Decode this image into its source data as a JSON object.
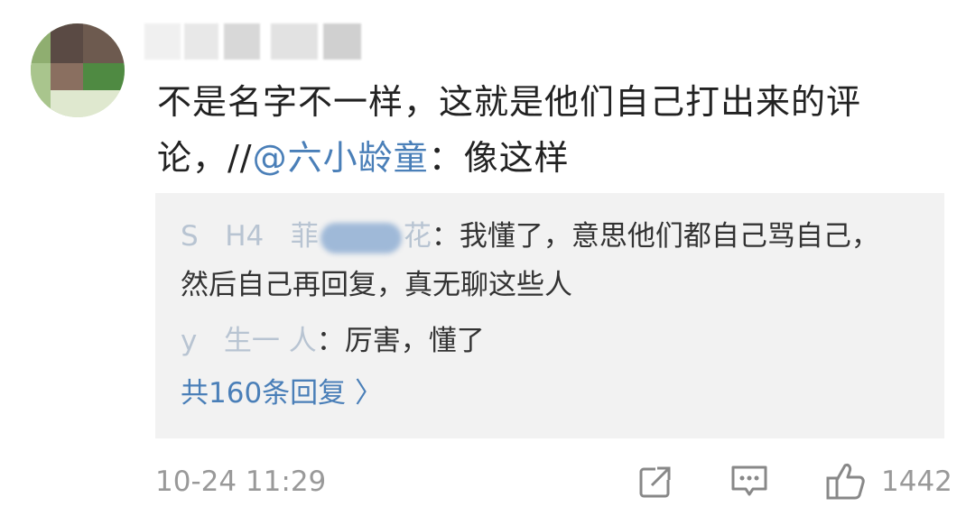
{
  "comment": {
    "text_part1": "不是名字不一样，这就是他们自己打出来的评论，//",
    "mention": "@六小龄童",
    "text_part2": "：像这样"
  },
  "replies": [
    {
      "name_visible": "S   H4   菲   花",
      "text": "：我懂了，意思他们都自己骂自己，",
      "text_cont": "然后自己再回复，真无聊这些人"
    },
    {
      "name_visible": "y   生一 人",
      "text": "：厉害，懂了"
    }
  ],
  "more_replies": "共160条回复 〉",
  "footer": {
    "timestamp": "10-24 11:29",
    "share_icon": "share-icon",
    "comment_icon": "comment-icon",
    "like_icon": "thumbs-up-icon",
    "like_count": "1442"
  },
  "colors": {
    "link": "#4a7fb8",
    "text": "#222222",
    "muted": "#999999",
    "reply_bg": "#f2f2f2"
  }
}
